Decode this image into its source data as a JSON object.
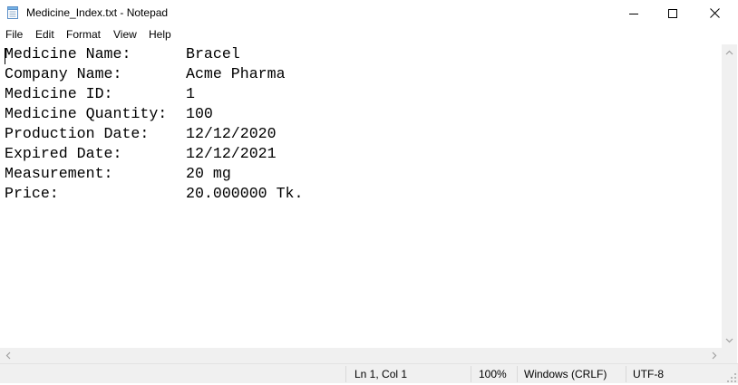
{
  "window": {
    "title": "Medicine_Index.txt - Notepad",
    "app_icon": "notepad-icon",
    "controls": [
      "minimize-icon",
      "maximize-icon",
      "close-icon"
    ]
  },
  "menu": {
    "items": [
      "File",
      "Edit",
      "Format",
      "View",
      "Help"
    ]
  },
  "document": {
    "lines": [
      {
        "label": "Medicine Name:",
        "value": "Bracel"
      },
      {
        "label": "Company Name:",
        "value": "Acme Pharma"
      },
      {
        "label": "Medicine ID:",
        "value": "1"
      },
      {
        "label": "Medicine Quantity:",
        "value": "100"
      },
      {
        "label": "Production Date:",
        "value": "12/12/2020"
      },
      {
        "label": "Expired Date:",
        "value": "12/12/2021"
      },
      {
        "label": "Measurement:",
        "value": "20 mg"
      },
      {
        "label": "Price:",
        "value": "20.000000 Tk."
      }
    ]
  },
  "status": {
    "position": "Ln 1, Col 1",
    "zoom": "100%",
    "line_ending": "Windows (CRLF)",
    "encoding": "UTF-8"
  }
}
